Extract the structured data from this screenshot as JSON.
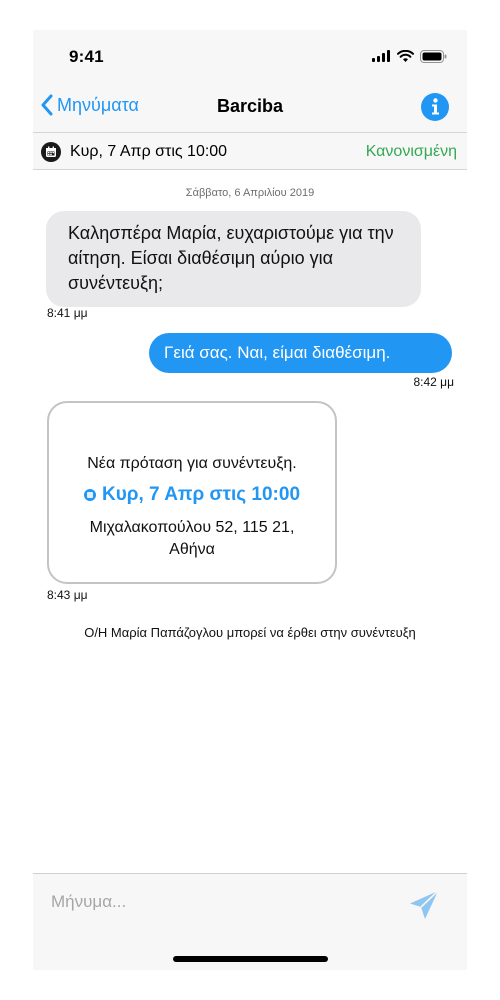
{
  "status_bar": {
    "time": "9:41"
  },
  "nav": {
    "back_label": "Μηνύματα",
    "title": "Barciba",
    "info_icon": "info-icon"
  },
  "appointment_bar": {
    "date": "Κυρ, 7 Απρ στις 10:00",
    "status": "Κανονισμένη",
    "status_color": "#34a853"
  },
  "conversation": {
    "date_header": "Σάββατο, 6 Απριλίου 2019",
    "messages": [
      {
        "text": "Καλησπέρα Μαρία, ευχαριστούμε για την αίτηση. Είσαι διαθέσιμη αύριο για συνέντευξη;",
        "time": "8:41 μμ"
      },
      {
        "text": "Γειά σας. Ναι, είμαι διαθέσιμη.",
        "time": "8:42 μμ"
      }
    ],
    "proposal_card": {
      "title": "Νέα πρόταση για συνέντευξη.",
      "date": "Κυρ, 7 Απρ στις 10:00",
      "address": "Μιχαλακοπούλου 52, 115 21, Αθήνα",
      "time": "8:43 μμ"
    },
    "system_note": "Ο/Η Μαρία Παπάζογλου μπορεί να έρθει στην συνέντευξη"
  },
  "compose": {
    "placeholder": "Μήνυμα...",
    "send_icon": "send-icon"
  },
  "colors": {
    "accent": "#2196f3",
    "incoming_bubble": "#e9e9eb",
    "bar_background": "#f7f7f7"
  }
}
